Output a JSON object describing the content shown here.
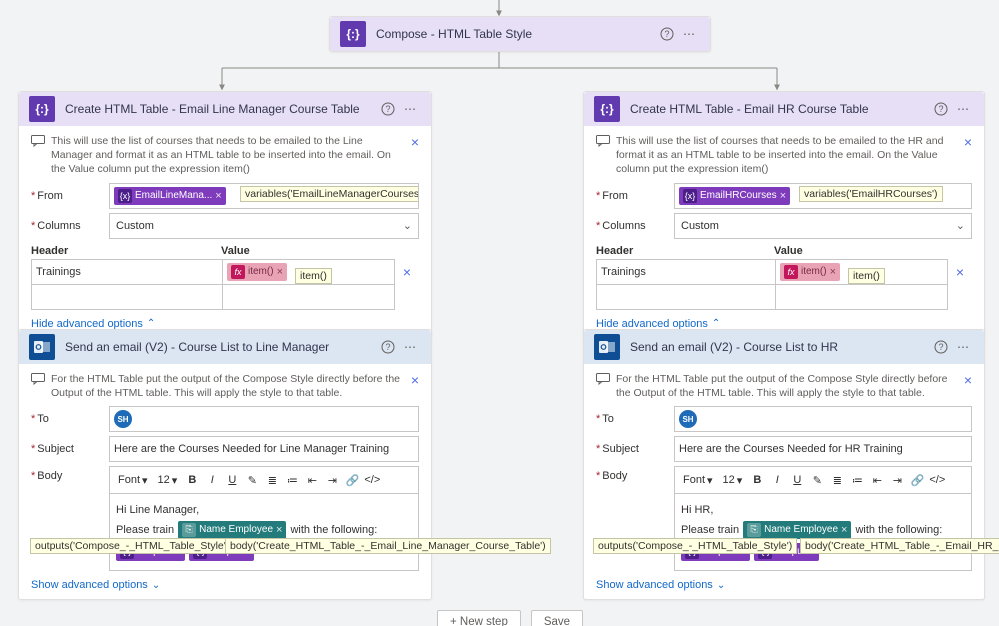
{
  "compose": {
    "title": "Compose - HTML Table Style"
  },
  "lm_table": {
    "title": "Create HTML Table - Email Line Manager Course Table",
    "note": "This will use the list of courses that needs to be emailed to the Line Manager and format it as an HTML table to be inserted into the email. On the Value column put the expression item()",
    "from_label": "From",
    "from_token": "EmailLineMana...",
    "from_tooltip": "variables('EmailLineManagerCourses')",
    "columns_label": "Columns",
    "columns_value": "Custom",
    "header_lbl": "Header",
    "value_lbl": "Value",
    "row1_header": "Trainings",
    "row1_value_token": "item()",
    "row1_value_tooltip": "item()",
    "hide_adv": "Hide advanced options"
  },
  "hr_table": {
    "title": "Create HTML Table - Email HR Course Table",
    "note": "This will use the list of courses that needs to be emailed to the HR and format it as an HTML table to be inserted into the email. On the Value column put the expression item()",
    "from_label": "From",
    "from_token": "EmailHRCourses",
    "from_tooltip": "variables('EmailHRCourses')",
    "columns_label": "Columns",
    "columns_value": "Custom",
    "header_lbl": "Header",
    "value_lbl": "Value",
    "row1_header": "Trainings",
    "row1_value_token": "item()",
    "row1_value_tooltip": "item()",
    "hide_adv": "Hide advanced options"
  },
  "lm_email": {
    "title": "Send an email (V2) - Course List to Line Manager",
    "note": "For the HTML Table put the output of the Compose Style directly before the Output of the HTML table. This will apply the style to that table.",
    "to_label": "To",
    "to_badge": "SH",
    "subject_label": "Subject",
    "subject_value": "Here are the Courses Needed for Line Manager Training",
    "body_label": "Body",
    "font_label": "Font",
    "size_label": "12",
    "greeting": "Hi Line Manager,",
    "line2_pre": "Please train",
    "line2_token": "Name Employee",
    "line2_post": "with the following:",
    "out1": "Outputs",
    "out2": "Output",
    "out1_tip": "outputs('Compose_-_HTML_Table_Style')",
    "out2_tip": "body('Create_HTML_Table_-_Email_Line_Manager_Course_Table')",
    "show_adv": "Show advanced options"
  },
  "hr_email": {
    "title": "Send an email (V2) - Course List to HR",
    "note": "For the HTML Table put the output of the Compose Style directly before the Output of the HTML table. This will apply the style to that table.",
    "to_label": "To",
    "to_badge": "SH",
    "subject_label": "Subject",
    "subject_value": "Here are the Courses Needed for HR Training",
    "body_label": "Body",
    "font_label": "Font",
    "size_label": "12",
    "greeting": "Hi HR,",
    "line2_pre": "Please train",
    "line2_token": "Name Employee",
    "line2_post": "with the following:",
    "out1": "Outputs",
    "out2": "Output",
    "out1_tip": "outputs('Compose_-_HTML_Table_Style')",
    "out2_tip": "body('Create_HTML_Table_-_Email_HR_Course_Table')",
    "show_adv": "Show advanced options"
  },
  "footer": {
    "new_step": "+ New step",
    "save": "Save"
  },
  "icons": {
    "brace": "{:}",
    "fx": "fx",
    "x": "×",
    "chev_down": "⌄",
    "chev_up": "⌃",
    "help": "?",
    "menu": "⋯",
    "comment": "🗨",
    "bold": "B",
    "italic": "I",
    "underline": "U",
    "list_bull": "≣",
    "list_num": "≔",
    "outdent": "⇤",
    "indent": "⇥",
    "link": "🔗",
    "code": "</>"
  }
}
